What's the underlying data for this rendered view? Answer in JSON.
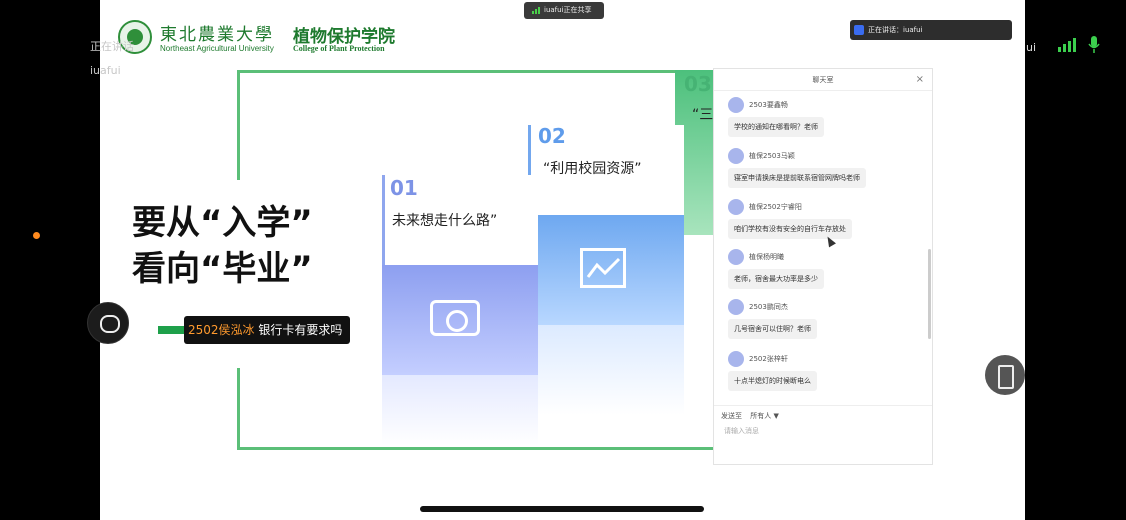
{
  "header": {
    "univ_cn": "東北農業大學",
    "univ_en": "Northeast Agricultural University",
    "college_cn": "植物保护学院",
    "college_en": "College of Plant Protection"
  },
  "slide": {
    "title_line1": "要从“入学”",
    "title_line2": "看向“毕业”",
    "steps": [
      {
        "num": "01",
        "text": "未来想走什么路”"
      },
      {
        "num": "02",
        "text": "“利用校园资源”"
      },
      {
        "num": "03",
        "text": "“三"
      }
    ]
  },
  "comment_overlay": {
    "user": "2502侯泓冰",
    "text": " 银行卡有要求吗"
  },
  "chat": {
    "title": "聊天室",
    "close": "×",
    "messages": [
      {
        "name": "2503要鑫畅",
        "text": "学校的通知在哪看啊？老师"
      },
      {
        "name": "植保2503马颖",
        "text": "寝室申请换床是提前联系宿管网牌吗老师"
      },
      {
        "name": "植保2502宁睿阳",
        "text": "咱们学校有没有安全的自行车存放处"
      },
      {
        "name": "植保杨明曦",
        "text": "老师，宿舍最大功率是多少"
      },
      {
        "name": "2503鹏同杰",
        "text": "几号宿舍可以住啊？老师"
      },
      {
        "name": "2502张梓轩",
        "text": "十点半熄灯的时候断电么"
      }
    ],
    "send_to_label": "发送至",
    "send_to_value": "所有人 ▼",
    "input_placeholder": "请输入消息"
  },
  "overlay": {
    "share_badge": "iuafui正在共享",
    "speaking": "正在讲话：iuafui",
    "left_text_1": "正在讲话",
    "left_text_2": "iuafui",
    "right_user": "ui"
  }
}
